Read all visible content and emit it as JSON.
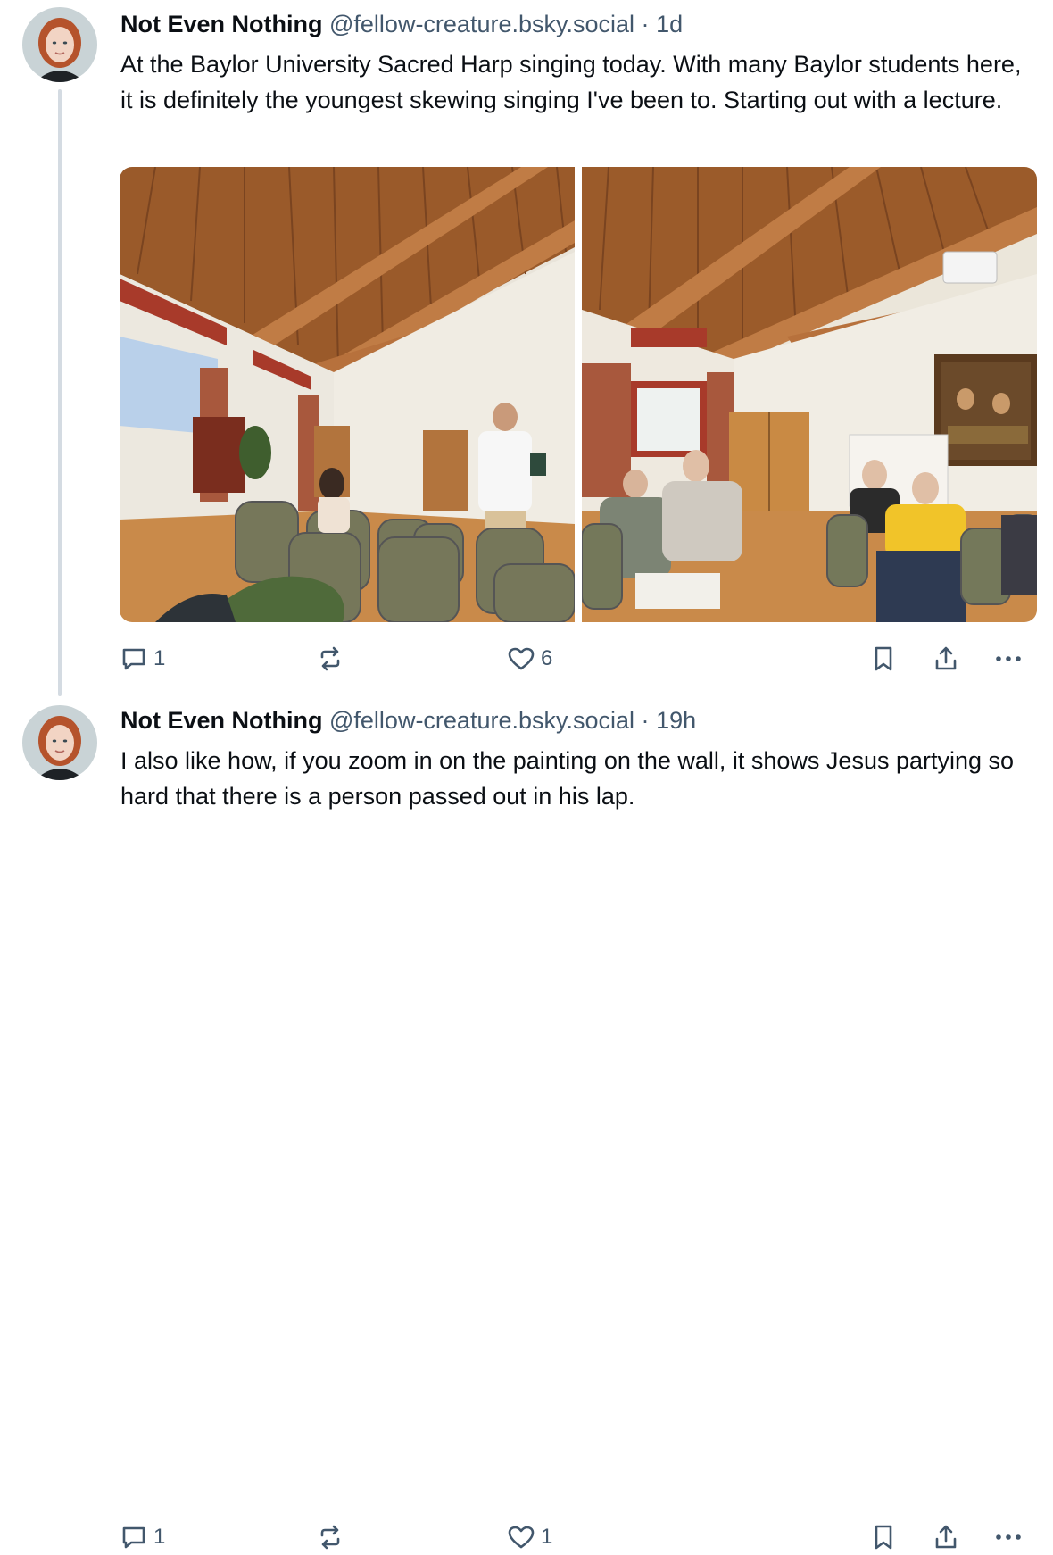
{
  "posts": [
    {
      "author": {
        "display_name": "Not Even Nothing",
        "handle": "@fellow-creature.bsky.social"
      },
      "separator": "·",
      "timestamp": "1d",
      "text": "At the Baylor University Sacred Harp singing today. With many Baylor students here, it is definitely the youngest skewing singing I've been to. Starting out with a lecture.",
      "images": [
        {
          "icon": "photo-lecture-hall"
        },
        {
          "icon": "photo-singers-seated"
        }
      ],
      "stats": {
        "replies": "1",
        "reposts": "",
        "likes": "6"
      }
    },
    {
      "author": {
        "display_name": "Not Even Nothing",
        "handle": "@fellow-creature.bsky.social"
      },
      "separator": "·",
      "timestamp": "19h",
      "text": "I also like how, if you zoom in on the painting on the wall, it shows Jesus partying so hard that there is a person passed out in his lap.",
      "stats": {
        "replies": "1",
        "reposts": "",
        "likes": "1"
      }
    }
  ],
  "icons": {
    "reply": "speech-bubble-icon",
    "repost": "repost-arrows-icon",
    "like": "heart-icon",
    "bookmark": "bookmark-icon",
    "share": "share-upload-icon",
    "more": "ellipsis-icon"
  },
  "colors": {
    "text": "#0b0f14",
    "muted": "#42576c",
    "thread_line": "#d4dbe2"
  }
}
